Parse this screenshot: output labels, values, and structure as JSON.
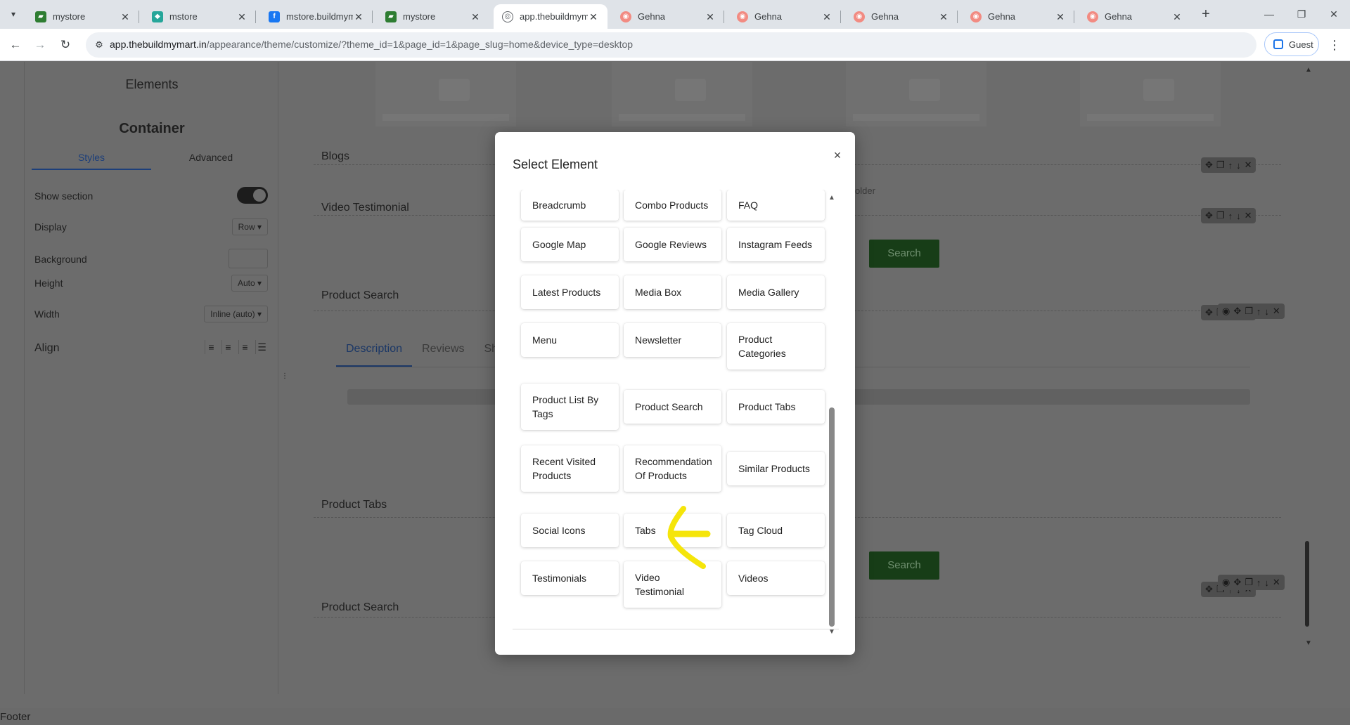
{
  "browser": {
    "tabs": [
      {
        "title": "mystore",
        "favicon": "store-favicon",
        "color": "#2e7d32"
      },
      {
        "title": "mstore",
        "favicon": "shop-favicon",
        "color": "#26a69a"
      },
      {
        "title": "mstore.buildmym",
        "favicon": "facebook-favicon",
        "color": "#1877f2"
      },
      {
        "title": "mystore",
        "favicon": "store-favicon",
        "color": "#2e7d32"
      },
      {
        "title": "app.thebuildmym",
        "favicon": "globe-favicon",
        "color": "#5f6368",
        "active": true
      },
      {
        "title": "Gehna",
        "favicon": "gehna-favicon",
        "color": "#f28b82"
      },
      {
        "title": "Gehna",
        "favicon": "gehna-favicon",
        "color": "#f28b82"
      },
      {
        "title": "Gehna",
        "favicon": "gehna-favicon",
        "color": "#f28b82"
      },
      {
        "title": "Gehna",
        "favicon": "gehna-favicon",
        "color": "#f28b82"
      },
      {
        "title": "Gehna",
        "favicon": "gehna-favicon",
        "color": "#f28b82"
      }
    ],
    "url_host": "app.thebuildmymart.in",
    "url_path": "/appearance/theme/customize/?theme_id=1&page_id=1&page_slug=home&device_type=desktop",
    "profile_label": "Guest"
  },
  "left_panel": {
    "heading": "Elements",
    "subheading": "Container",
    "tabs": [
      "Styles",
      "Advanced"
    ],
    "show_section_label": "Show section",
    "display_label": "Display",
    "display_value": "Row",
    "background_label": "Background",
    "height_label": "Height",
    "height_value": "Auto",
    "width_label": "Width",
    "width_value": "Inline (auto)",
    "align_label": "Align"
  },
  "canvas": {
    "labels": {
      "blogs": "Blogs",
      "video_testimonial": "Video Testimonial",
      "product_search_1": "Product Search",
      "product_tabs": "Product Tabs",
      "product_search_2": "Product Search"
    },
    "placeholder_text": "older",
    "search_button": "Search",
    "desc_tabs": [
      "Description",
      "Reviews",
      "Sh"
    ],
    "footer": "Footer"
  },
  "modal": {
    "title": "Select Element",
    "close": "×",
    "elements": [
      "Breadcrumb",
      "Combo Products",
      "FAQ",
      "Google Map",
      "Google Reviews",
      "Instagram Feeds",
      "Latest Products",
      "Media Box",
      "Media Gallery",
      "Menu",
      "Newsletter",
      "Product Categories",
      "Product List By Tags",
      "Product Search",
      "Product Tabs",
      "Recent Visited Products",
      "Recommendation Of Products",
      "Similar Products",
      "Social Icons",
      "Tabs",
      "Tag Cloud",
      "Testimonials",
      "Video Testimonial",
      "Videos"
    ]
  },
  "colors": {
    "accent": "#1a73e8",
    "annotation": "#f5e50a",
    "search_button": "#173d17"
  }
}
